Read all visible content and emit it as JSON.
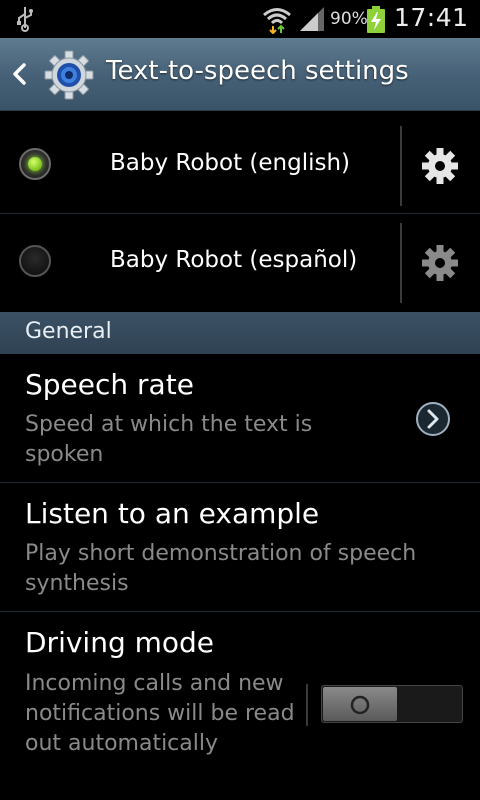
{
  "status_bar": {
    "battery_percent": "90%",
    "time": "17:41",
    "icons": [
      "usb-icon",
      "wifi-icon",
      "signal-icon",
      "battery-charging-icon"
    ]
  },
  "action_bar": {
    "title": "Text-to-speech settings",
    "icons": [
      "back-icon",
      "settings-gear-app-icon"
    ]
  },
  "engines": [
    {
      "label": "Baby Robot (english)",
      "selected": true
    },
    {
      "label": "Baby Robot (español)",
      "selected": false
    }
  ],
  "general": {
    "header": "General",
    "speech_rate": {
      "title": "Speech rate",
      "summary": "Speed at which the text is spoken"
    },
    "listen_example": {
      "title": "Listen to an example",
      "summary": "Play short demonstration of speech synthesis"
    },
    "driving_mode": {
      "title": "Driving mode",
      "summary": "Incoming calls and new notifications will be read out automatically",
      "enabled": false
    }
  },
  "colors": {
    "action_bar": "#4f6a80",
    "section_header": "#34495b",
    "radio_selected": "#8ddc2a",
    "summary_text": "#8a8a8a"
  }
}
